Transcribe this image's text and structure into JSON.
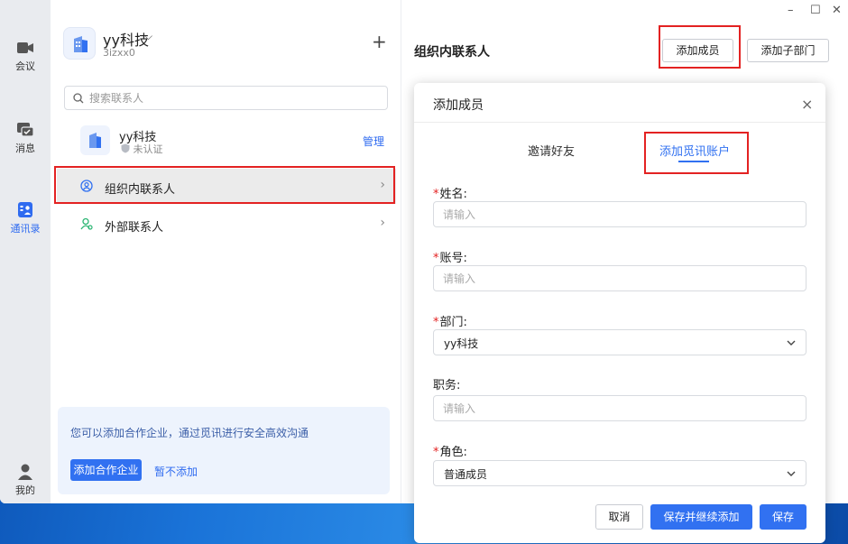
{
  "nav": {
    "items": [
      {
        "label": "会议",
        "icon": "video-camera-icon"
      },
      {
        "label": "消息",
        "icon": "chat-bubble-icon"
      },
      {
        "label": "通讯录",
        "icon": "contacts-icon"
      },
      {
        "label": "我的",
        "icon": "user-icon"
      }
    ],
    "active_index": 2
  },
  "org": {
    "name": "yy科技",
    "id": "3izxx0"
  },
  "search": {
    "placeholder": "搜索联系人"
  },
  "org_card": {
    "name": "yy科技",
    "status": "未认证",
    "manage_label": "管理"
  },
  "contacts_list": [
    {
      "label": "组织内联系人",
      "icon": "user-circle-icon",
      "selected": true
    },
    {
      "label": "外部联系人",
      "icon": "external-user-icon",
      "selected": false
    }
  ],
  "promo": {
    "text": "您可以添加合作企业，通过觅讯进行安全高效沟通",
    "button_label": "添加合作企业",
    "skip_label": "暂不添加"
  },
  "right": {
    "title": "组织内联系人",
    "add_member_label": "添加成员",
    "add_subdept_label": "添加子部门"
  },
  "modal": {
    "title": "添加成员",
    "tabs": [
      {
        "label": "邀请好友",
        "active": false
      },
      {
        "label": "添加觅讯账户",
        "active": true
      }
    ],
    "fields": {
      "name": {
        "label": "姓名:",
        "required": true,
        "placeholder": "请输入",
        "value": ""
      },
      "account": {
        "label": "账号:",
        "required": true,
        "placeholder": "请输入",
        "value": ""
      },
      "department": {
        "label": "部门:",
        "required": true,
        "value": "yy科技"
      },
      "position": {
        "label": "职务:",
        "required": false,
        "placeholder": "请输入",
        "value": ""
      },
      "role": {
        "label": "角色:",
        "required": true,
        "value": "普通成员"
      }
    },
    "buttons": {
      "cancel": "取消",
      "save_continue": "保存并继续添加",
      "save": "保存"
    }
  },
  "colors": {
    "accent": "#3171f1",
    "highlight": "#e32222",
    "nav_bg": "#e9ebef"
  }
}
